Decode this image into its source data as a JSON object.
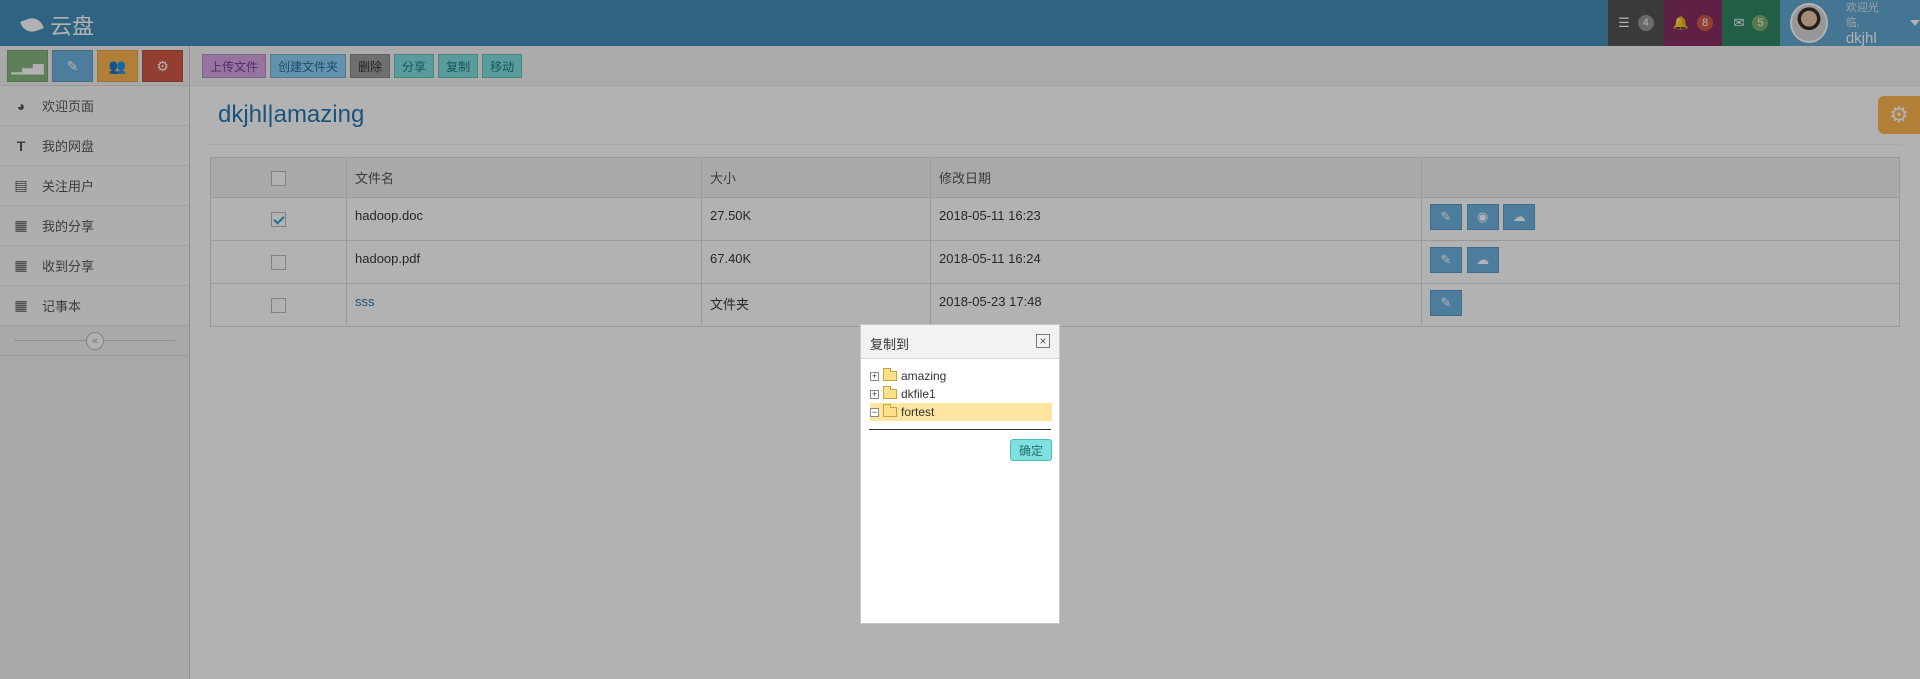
{
  "navbar": {
    "brand": "云盘",
    "tasks_count": "4",
    "notifications_count": "8",
    "messages_count": "5",
    "user_welcome": "欢迎光临,",
    "user_name": "dkjhl"
  },
  "sidebar": {
    "items": [
      {
        "label": "欢迎页面",
        "icon": "dashboard-icon"
      },
      {
        "label": "我的网盘",
        "icon": "text-icon"
      },
      {
        "label": "关注用户",
        "icon": "list-icon"
      },
      {
        "label": "我的分享",
        "icon": "calendar-icon"
      },
      {
        "label": "收到分享",
        "icon": "calendar-icon"
      },
      {
        "label": "记事本",
        "icon": "calendar-icon"
      }
    ]
  },
  "toolbar": {
    "upload": "上传文件",
    "create_folder": "创建文件夹",
    "delete": "删除",
    "share": "分享",
    "copy": "复制",
    "move": "移动"
  },
  "page": {
    "title": "dkjhl|amazing"
  },
  "table": {
    "headers": [
      "文件名",
      "大小",
      "修改日期"
    ],
    "rows": [
      {
        "name": "hadoop.doc",
        "size": "27.50K",
        "date": "2018-05-11 16:23",
        "checked": true
      },
      {
        "name": "hadoop.pdf",
        "size": "67.40K",
        "date": "2018-05-11 16:24",
        "checked": false
      },
      {
        "name": "sss",
        "size": "文件夹",
        "date": "2018-05-23 17:48",
        "checked": false
      }
    ]
  },
  "dialog": {
    "title": "复制到",
    "close": "×",
    "folders": [
      {
        "name": "amazing",
        "expander": "+"
      },
      {
        "name": "dkfile1",
        "expander": "+"
      },
      {
        "name": "fortest",
        "expander": "−",
        "selected": true
      }
    ],
    "ok": "确定"
  },
  "colors": {
    "navbar": "#438eb9",
    "accent": "#2679b5",
    "overlay": "rgba(0,0,0,0.3)"
  }
}
